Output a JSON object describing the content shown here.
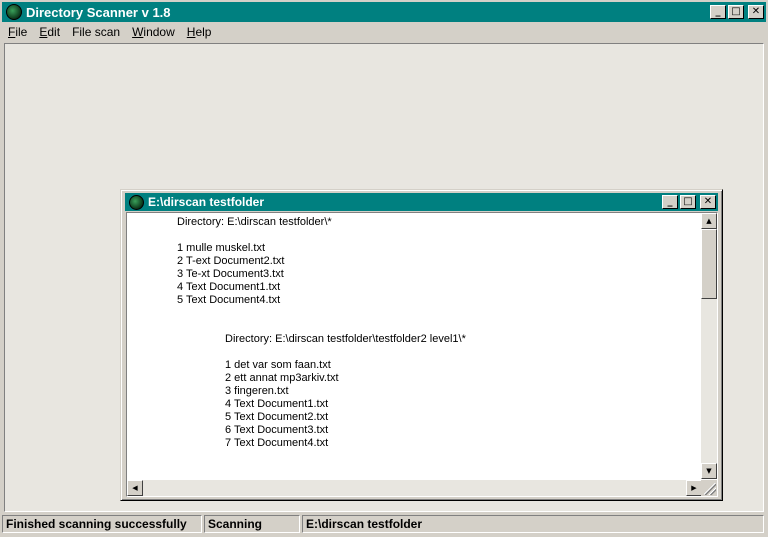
{
  "app": {
    "title": "Directory Scanner v 1.8",
    "icon": "scanner-globe-icon",
    "window_controls": {
      "minimize": "_",
      "maximize": "□",
      "close": "✕"
    }
  },
  "menu": [
    {
      "label": "File",
      "accel": "F",
      "rest": "ile"
    },
    {
      "label": "Edit",
      "accel": "E",
      "rest": "dit"
    },
    {
      "label": "File scan",
      "accel": "",
      "rest": "File scan"
    },
    {
      "label": "Window",
      "accel": "W",
      "rest": "indow"
    },
    {
      "label": "Help",
      "accel": "H",
      "rest": "elp"
    }
  ],
  "child_window": {
    "title": "E:\\dirscan testfolder",
    "listing": [
      {
        "directory_line": "Directory:  E:\\dirscan testfolder\\*",
        "files": [
          "1  mulle muskel.txt",
          "2  T-ext Document2.txt",
          "3  Te-xt Document3.txt",
          "4  Text Document1.txt",
          "5  Text Document4.txt"
        ]
      },
      {
        "directory_line": "Directory:  E:\\dirscan testfolder\\testfolder2 level1\\*",
        "files": [
          "1  det var som faan.txt",
          "2  ett annat mp3arkiv.txt",
          "3  fingeren.txt",
          "4  Text Document1.txt",
          "5  Text Document2.txt",
          "6  Text Document3.txt",
          "7  Text Document4.txt"
        ]
      }
    ]
  },
  "status": {
    "message": "Finished scanning successfully",
    "state": "Scanning",
    "path": "E:\\dirscan testfolder"
  },
  "colors": {
    "titlebar": "#008080",
    "face": "#d4d0c8",
    "workspace": "#e8e6e0"
  }
}
